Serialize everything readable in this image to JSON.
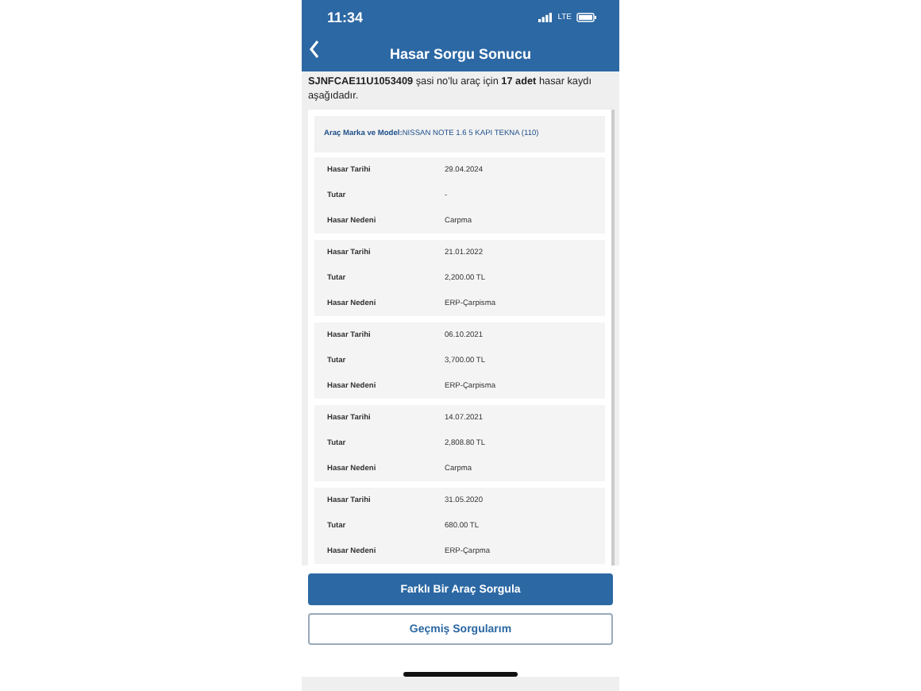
{
  "status_bar": {
    "time": "11:34",
    "network": "LTE"
  },
  "nav": {
    "title": "Hasar Sorgu Sonucu"
  },
  "intro": "**SJNFCAE11U1053409** şasi no'lu araç için **17 adet** hasar kaydı aşağıdadır.",
  "vehicle": {
    "label": "Araç Marka ve Model:",
    "value": "NISSAN NOTE 1.6 5 KAPI TEKNA (110)"
  },
  "records": [
    {
      "rows": [
        {
          "label": "Hasar Tarihi",
          "value": "29.04.2024"
        },
        {
          "label": "Tutar",
          "value": "-"
        },
        {
          "label": "Hasar Nedeni",
          "value": "Carpma"
        }
      ]
    },
    {
      "rows": [
        {
          "label": "Hasar Tarihi",
          "value": "21.01.2022"
        },
        {
          "label": "Tutar",
          "value": "2,200.00 TL"
        },
        {
          "label": "Hasar Nedeni",
          "value": "ERP-Çarpisma"
        }
      ]
    },
    {
      "rows": [
        {
          "label": "Hasar Tarihi",
          "value": "06.10.2021"
        },
        {
          "label": "Tutar",
          "value": "3,700.00 TL"
        },
        {
          "label": "Hasar Nedeni",
          "value": "ERP-Çarpisma"
        }
      ]
    },
    {
      "rows": [
        {
          "label": "Hasar Tarihi",
          "value": "14.07.2021"
        },
        {
          "label": "Tutar",
          "value": "2,808.80 TL"
        },
        {
          "label": "Hasar Nedeni",
          "value": "Carpma"
        }
      ]
    },
    {
      "rows": [
        {
          "label": "Hasar Tarihi",
          "value": "31.05.2020"
        },
        {
          "label": "Tutar",
          "value": "680.00 TL"
        },
        {
          "label": "Hasar Nedeni",
          "value": "ERP-Çarpma"
        }
      ]
    }
  ],
  "buttons": [
    {
      "label": "Farklı Bir Araç Sorgula",
      "kind": "primary"
    },
    {
      "label": "Geçmiş Sorgularım",
      "kind": "secondary"
    }
  ]
}
